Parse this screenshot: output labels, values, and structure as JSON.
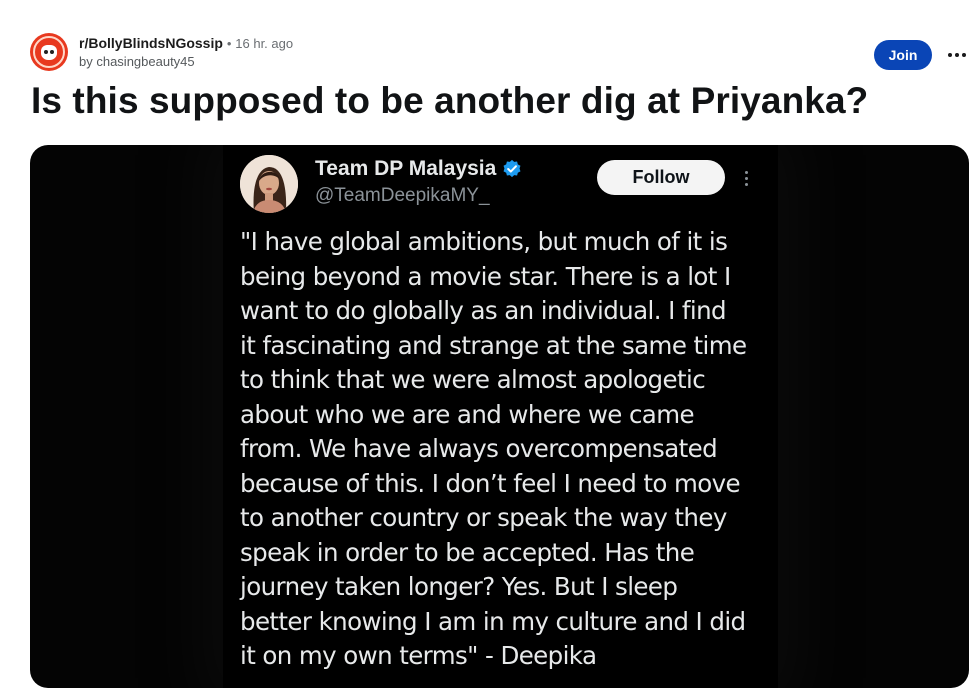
{
  "post": {
    "subreddit": "r/BollyBlindsNGossip",
    "separator": "•",
    "time": "16 hr. ago",
    "author": "by chasingbeauty45",
    "join_label": "Join",
    "more_icon": "more-horizontal-icon",
    "title": "Is this supposed to be another dig at Priyanka?"
  },
  "tweet": {
    "name": "Team DP Malaysia",
    "handle": "@TeamDeepikaMY_",
    "follow_label": "Follow",
    "verified_icon": "verified-badge-icon",
    "more_icon": "more-vertical-icon",
    "text": "\"I have global ambitions, but much of it is\nbeing beyond a movie star. There is a lot I\nwant to do globally as an individual. I find\nit fascinating and strange at the same time\nto think that we were almost apologetic\nabout who we are and where we came\nfrom. We have always overcompensated\nbecause of this. I don’t feel I need to move\nto another country or speak the way they\nspeak in order to be accepted. Has the\njourney taken longer? Yes. But I sleep\nbetter knowing I am in my culture and I did\nit on my own terms\" - Deepika"
  },
  "colors": {
    "join_button": "#0a45b6",
    "subreddit_avatar": "#e8391f",
    "verified_badge": "#1d9bf0",
    "tweet_background": "#000000",
    "tweet_text": "#e7e9ea"
  }
}
